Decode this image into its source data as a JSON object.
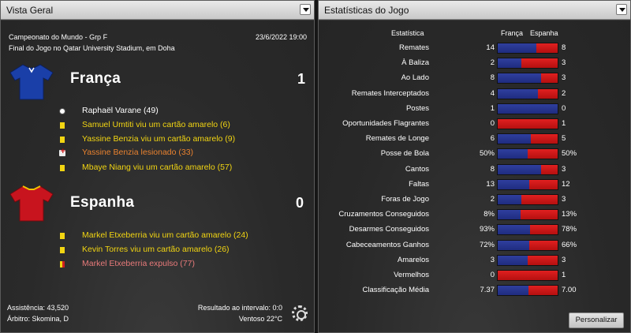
{
  "left_panel": {
    "title": "Vista Geral"
  },
  "match": {
    "competition": "Campeonato do Mundo - Grp F",
    "datetime": "23/6/2022 19:00",
    "venue": "Final do Jogo no Qatar University Stadium, em Doha"
  },
  "home": {
    "name": "França",
    "score": "1",
    "shirt_color": "#1a3fa8",
    "events": [
      {
        "icon": "goal-ball",
        "text": "Raphaël Varane (49)",
        "color": "white"
      },
      {
        "icon": "yellow-card",
        "text": "Samuel Umtiti viu um cartão amarelo (6)",
        "color": "yellow"
      },
      {
        "icon": "yellow-card",
        "text": "Yassine Benzia viu um cartão amarelo (9)",
        "color": "yellow"
      },
      {
        "icon": "injury",
        "text": "Yassine Benzia lesionado (33)",
        "color": "orange"
      },
      {
        "icon": "yellow-card",
        "text": "Mbaye Niang viu um cartão amarelo (57)",
        "color": "yellow"
      }
    ]
  },
  "away": {
    "name": "Espanha",
    "score": "0",
    "shirt_color": "#c8141e",
    "events": [
      {
        "icon": "yellow-card",
        "text": "Markel Etxeberria viu um cartão amarelo (24)",
        "color": "yellow"
      },
      {
        "icon": "yellow-card",
        "text": "Kevin Torres viu um cartão amarelo (26)",
        "color": "yellow"
      },
      {
        "icon": "second-yellow-red-card",
        "text": "Markel Etxeberria expulso (77)",
        "color": "pink"
      }
    ]
  },
  "footer": {
    "attendance": "Assistência: 43,520",
    "referee": "Árbitro: Skomina, D",
    "halftime": "Resultado ao intervalo: 0:0",
    "weather": "Ventoso 22°C"
  },
  "right_panel": {
    "title": "Estatísticas do Jogo",
    "col_stat": "Estatística",
    "col_home": "França",
    "col_away": "Espanha",
    "customize_label": "Personalizar",
    "home_color": "#2a3a9a",
    "away_color": "#d41818"
  },
  "stats": [
    {
      "label": "Remates",
      "home": "14",
      "away": "8",
      "home_share": 0.64
    },
    {
      "label": "À Baliza",
      "home": "2",
      "away": "3",
      "home_share": 0.4
    },
    {
      "label": "Ao Lado",
      "home": "8",
      "away": "3",
      "home_share": 0.73
    },
    {
      "label": "Remates Interceptados",
      "home": "4",
      "away": "2",
      "home_share": 0.67
    },
    {
      "label": "Postes",
      "home": "1",
      "away": "0",
      "home_share": 1.0
    },
    {
      "label": "Oportunidades Flagrantes",
      "home": "0",
      "away": "1",
      "home_share": 0.0
    },
    {
      "label": "Remates de Longe",
      "home": "6",
      "away": "5",
      "home_share": 0.55
    },
    {
      "label": "Posse de Bola",
      "home": "50%",
      "away": "50%",
      "home_share": 0.5
    },
    {
      "label": "Cantos",
      "home": "8",
      "away": "3",
      "home_share": 0.73
    },
    {
      "label": "Faltas",
      "home": "13",
      "away": "12",
      "home_share": 0.52
    },
    {
      "label": "Foras de Jogo",
      "home": "2",
      "away": "3",
      "home_share": 0.4
    },
    {
      "label": "Cruzamentos Conseguidos",
      "home": "8%",
      "away": "13%",
      "home_share": 0.38
    },
    {
      "label": "Desarmes Conseguidos",
      "home": "93%",
      "away": "78%",
      "home_share": 0.54
    },
    {
      "label": "Cabeceamentos Ganhos",
      "home": "72%",
      "away": "66%",
      "home_share": 0.52
    },
    {
      "label": "Amarelos",
      "home": "3",
      "away": "3",
      "home_share": 0.5
    },
    {
      "label": "Vermelhos",
      "home": "0",
      "away": "1",
      "home_share": 0.0
    },
    {
      "label": "Classificação Média",
      "home": "7.37",
      "away": "7.00",
      "home_share": 0.51
    }
  ]
}
